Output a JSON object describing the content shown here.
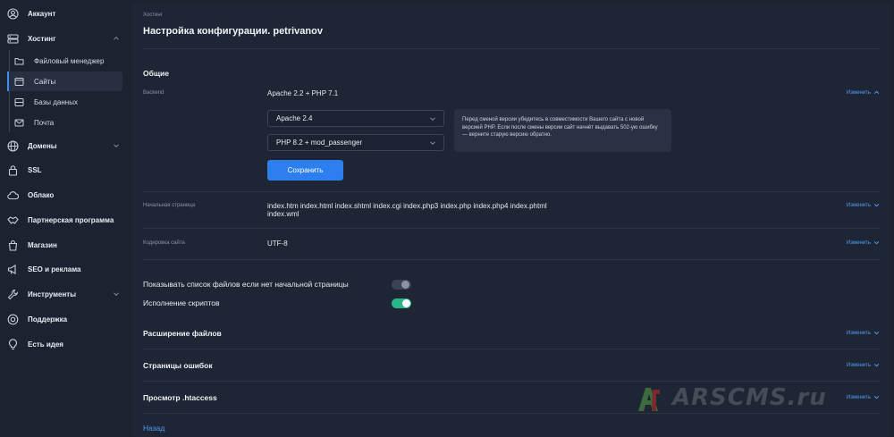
{
  "sidebar": {
    "account": "Аккаунт",
    "hosting": "Хостинг",
    "hosting_items": [
      "Файловый менеджер",
      "Сайты",
      "Базы данных",
      "Почта"
    ],
    "domains": "Домены",
    "ssl": "SSL",
    "cloud": "Облако",
    "partner": "Партнерская программа",
    "shop": "Магазин",
    "seo": "SEO и реклама",
    "tools": "Инструменты",
    "support": "Поддержка",
    "ideas": "Есть идея"
  },
  "header": {
    "breadcrumb": "Хостинг",
    "title": "Настройка конфигурации. petrivanov"
  },
  "general": {
    "title": "Общие",
    "backend_label": "Backend",
    "backend_value": "Apache 2.2 + PHP 7.1",
    "edit_open_label": "Изменить",
    "select_server": "Apache 2.4",
    "select_php": "PHP 8.2 + mod_passenger",
    "save_label": "Сохранить",
    "note": "Перед сменой версии убедитесь в совместимости Вашего сайта с новой версией PHP. Если после смены версии сайт начнёт выдавать 502-ую ошибку — верните старую версию обратно."
  },
  "start_page": {
    "label": "Начальная страница",
    "value_line1": "index.htm index.html index.shtml index.cgi index.php3 index.php index.php4 index.phtml",
    "value_line2": "index.wml",
    "edit_label": "Изменить"
  },
  "encoding": {
    "label": "Кодировка сайта",
    "value": "UTF-8",
    "edit_label": "Изменить"
  },
  "toggles": {
    "show_files_label": "Показывать список файлов если нет начальной страницы",
    "show_files_on": false,
    "scripts_label": "Исполнение скриптов",
    "scripts_on": true
  },
  "sections": {
    "extensions": "Расширение файлов",
    "error_pages": "Страницы ошибок",
    "htaccess": "Просмотр .htaccess",
    "edit_label": "Изменить"
  },
  "back_label": "Назад",
  "watermark": "ARSCMS.ru",
  "colors": {
    "accent": "#2d7ff0",
    "link": "#4f9cf5",
    "toggle_on": "#2bb58a"
  }
}
